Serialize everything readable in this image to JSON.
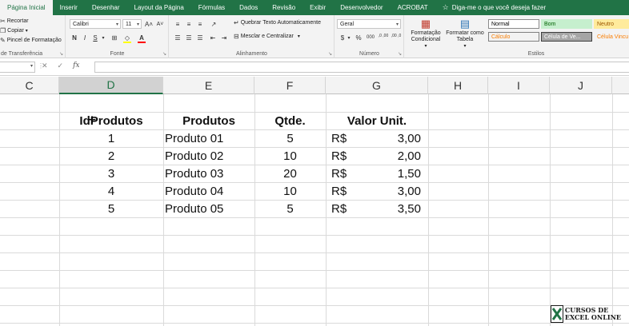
{
  "ribbon_tabs": [
    {
      "label": "Página Inicial",
      "active": true
    },
    {
      "label": "Inserir"
    },
    {
      "label": "Desenhar"
    },
    {
      "label": "Layout da Página"
    },
    {
      "label": "Fórmulas"
    },
    {
      "label": "Dados"
    },
    {
      "label": "Revisão"
    },
    {
      "label": "Exibir"
    },
    {
      "label": "Desenvolvedor"
    },
    {
      "label": "ACROBAT"
    }
  ],
  "tell_me": "Diga-me o que você deseja fazer",
  "clipboard": {
    "cut": "Recortar",
    "copy": "Copiar",
    "format_painter": "Pincel de Formatação",
    "label": "de Transferência"
  },
  "font": {
    "name": "Calibri",
    "size": "11",
    "bold": "N",
    "italic": "I",
    "underline": "S",
    "grow": "A˄",
    "shrink": "A˅",
    "label": "Fonte"
  },
  "alignment": {
    "wrap_text": "Quebrar Texto Automaticamente",
    "merge_center": "Mesclar e Centralizar",
    "label": "Alinhamento"
  },
  "number": {
    "format": "Geral",
    "currency": "$",
    "percent": "%",
    "thousands": "000",
    "inc_decimal": ",0 ,00",
    "dec_decimal": ",00 ,0",
    "label": "Número"
  },
  "styles_group": {
    "conditional": "Formatação Condicional",
    "format_table": "Formatar como Tabela",
    "label": "Estilos",
    "styles": [
      {
        "label": "Normal",
        "bg": "#ffffff",
        "fg": "#000000",
        "border": "#8a8a8a"
      },
      {
        "label": "Bom",
        "bg": "#c6efce",
        "fg": "#006100",
        "border": "#c6efce"
      },
      {
        "label": "Neutro",
        "bg": "#ffeb9c",
        "fg": "#9c5700",
        "border": "#ffeb9c"
      },
      {
        "label": "Cálculo",
        "bg": "#f2f2f2",
        "fg": "#fa7d00",
        "border": "#7f7f7f"
      },
      {
        "label": "Célula de Ve...",
        "bg": "#a5a5a5",
        "fg": "#ffffff",
        "border": "#3f3f3f"
      },
      {
        "label": "Célula Vincu",
        "bg": "#f3f3f3",
        "fg": "#fa7d00",
        "border": "#f3f3f3"
      }
    ]
  },
  "formula_bar": {
    "name_box": "",
    "cancel": "✕",
    "enter": "✓",
    "fx": "fx",
    "content": ""
  },
  "columns": [
    "C",
    "D",
    "E",
    "F",
    "G",
    "H",
    "I",
    "J"
  ],
  "selected_column": "D",
  "table": {
    "headers": {
      "id": "IdProdutos",
      "product": "Produtos",
      "qty": "Qtde.",
      "price": "Valor Unit."
    },
    "currency_symbol": "R$",
    "rows": [
      {
        "id": "1",
        "product": "Produto 01",
        "qty": "5",
        "price": "3,00"
      },
      {
        "id": "2",
        "product": "Produto 02",
        "qty": "10",
        "price": "2,00"
      },
      {
        "id": "3",
        "product": "Produto 03",
        "qty": "20",
        "price": "1,50"
      },
      {
        "id": "4",
        "product": "Produto 04",
        "qty": "10",
        "price": "3,00"
      },
      {
        "id": "5",
        "product": "Produto 05",
        "qty": "5",
        "price": "3,50"
      }
    ]
  },
  "logo": {
    "line1": "CURSOS DE",
    "line2": "EXCEL ONLINE"
  },
  "colors": {
    "excel_green": "#217346"
  }
}
